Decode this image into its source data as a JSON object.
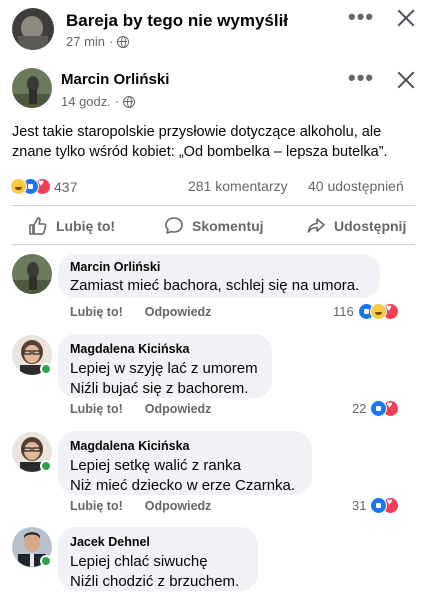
{
  "group": {
    "name": "Bareja by tego nie wymyślił",
    "time": "27 min",
    "separator": "·"
  },
  "post": {
    "author": "Marcin Orliński",
    "time": "14 godz.",
    "separator": "·",
    "text": "Jest takie staropolskie przysłowie dotyczące alkoholu, ale znane tylko wśród kobiet: „Od bombelka – lepsza butelka”.",
    "reaction_count": "437",
    "comments_count": "281 komentarzy",
    "shares_count": "40 udostępnień"
  },
  "actions": {
    "like": "Lubię to!",
    "comment": "Skomentuj",
    "share": "Udostępnij"
  },
  "comments": [
    {
      "author": "Marcin Orliński",
      "text": "Zamiast mieć bachora, schlej się na umora.",
      "like_label": "Lubię to!",
      "reply_label": "Odpowiedz",
      "reaction_count": "116",
      "reactions": [
        "like-icon",
        "haha-icon",
        "love-icon"
      ]
    },
    {
      "author": "Magdalena Kicińska",
      "text": "Lepiej w szyję lać z umorem\nNiźli bujać się z bachorem.",
      "like_label": "Lubię to!",
      "reply_label": "Odpowiedz",
      "reaction_count": "22",
      "reactions": [
        "like-icon",
        "love-icon"
      ]
    },
    {
      "author": "Magdalena Kicińska",
      "text": "Lepiej setkę walić z ranka\nNiż mieć dziecko w erze Czarnka.",
      "like_label": "Lubię to!",
      "reply_label": "Odpowiedz",
      "reaction_count": "31",
      "reactions": [
        "like-icon",
        "love-icon"
      ]
    },
    {
      "author": "Jacek Dehnel",
      "text": "Lepiej chlać siwuchę\nNiźli chodzić z brzuchem."
    }
  ],
  "colors": {
    "accent": "#1877f2",
    "love": "#f33e58",
    "haha": "#f7c945",
    "online": "#31a24c",
    "secondary_text": "#65676b",
    "bubble": "#f0f2f5"
  }
}
